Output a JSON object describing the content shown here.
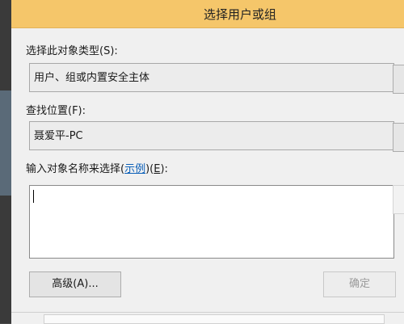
{
  "dialog": {
    "title": "选择用户或组"
  },
  "object_type": {
    "label": "选择此对象类型(S):",
    "value": "用户、组或内置安全主体"
  },
  "location": {
    "label": "查找位置(F):",
    "value": "聂爱平-PC"
  },
  "names": {
    "label_prefix": "输入对象名称来选择(",
    "link_text": "示例",
    "label_middle": ")(",
    "label_key": "E",
    "label_suffix": "):",
    "value": ""
  },
  "buttons": {
    "advanced_label": "高级(A)...",
    "ok_label": "确定"
  },
  "colors": {
    "title_bar": "#f5c66a",
    "link": "#0b5fb8"
  }
}
